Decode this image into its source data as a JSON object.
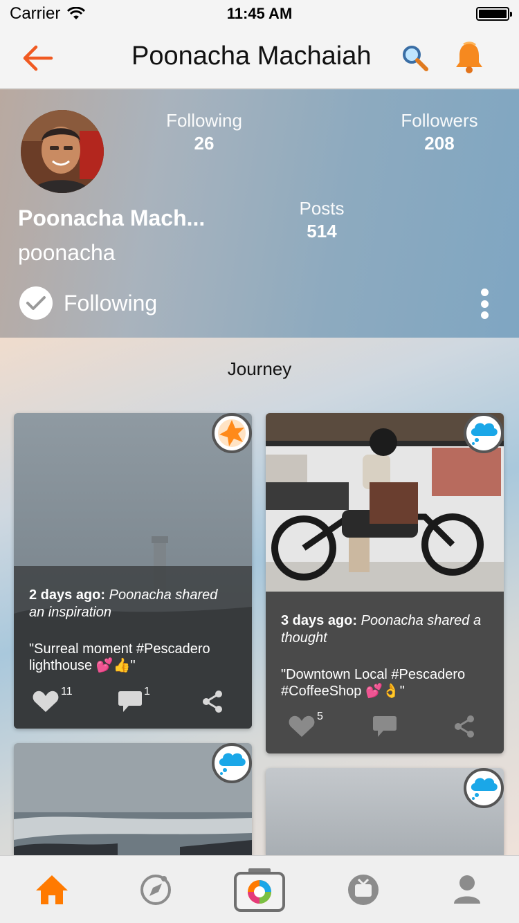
{
  "status_bar": {
    "carrier": "Carrier",
    "time": "11:45 AM"
  },
  "nav": {
    "title": "Poonacha Machaiah",
    "back_icon": "back-arrow-icon",
    "search_icon": "search-icon",
    "bell_icon": "bell-icon",
    "accent": "#f05a22"
  },
  "profile": {
    "name": "Poonacha Mach...",
    "username": "poonacha",
    "stats": {
      "following": {
        "label": "Following",
        "value": "26"
      },
      "followers": {
        "label": "Followers",
        "value": "208"
      },
      "posts": {
        "label": "Posts",
        "value": "514"
      }
    },
    "follow_label": "Following"
  },
  "journey": {
    "title": "Journey",
    "cards": [
      {
        "badge": "star-burst-icon",
        "when": "2 days ago:",
        "what": "Poonacha shared an inspiration",
        "quote": "\"Surreal moment #Pescadero lighthouse 💕👍\"",
        "likes": "11",
        "comments": "1"
      },
      {
        "badge": "thought-cloud-icon",
        "when": "3 days ago:",
        "what": "Poonacha shared a thought",
        "quote": "\"Downtown Local #Pescadero #CoffeeShop 💕👌\"",
        "likes": "5",
        "comments": ""
      },
      {
        "badge": "thought-cloud-icon"
      },
      {
        "badge": "thought-cloud-icon"
      }
    ]
  },
  "tabs": [
    "home-icon",
    "compass-icon",
    "camera-icon",
    "tv-icon",
    "profile-icon"
  ],
  "colors": {
    "tab_active": "#ff7a00",
    "tab_inactive": "#8c8c8c",
    "card_panel": "#4a4a4a"
  }
}
